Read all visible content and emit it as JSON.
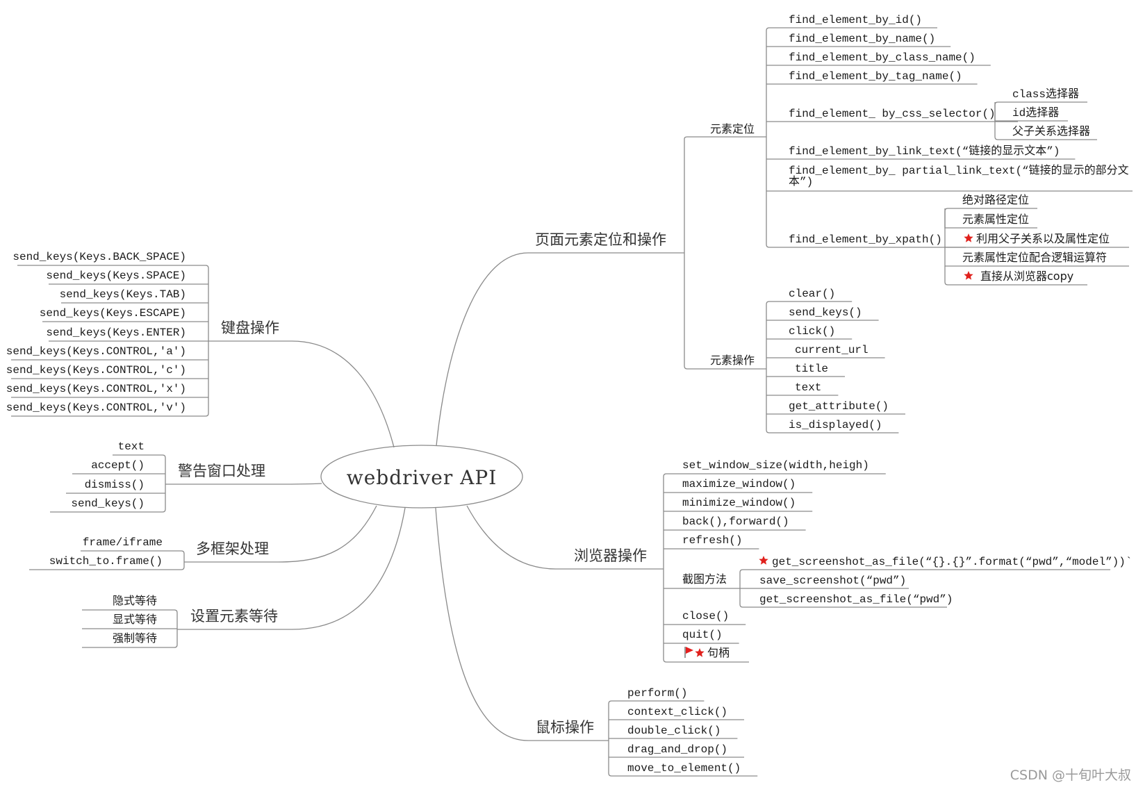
{
  "root": {
    "label": "webdriver API"
  },
  "watermark": "CSDN @十旬叶大叔",
  "colors": {
    "line": "#8a8a8a",
    "text": "#1a1a1a",
    "star": "#e0201c",
    "watermark": "#9a9a9a"
  },
  "branches": {
    "page_elements": {
      "label": "页面元素定位和操作",
      "locate": {
        "label": "元素定位",
        "items": [
          {
            "label": "find_element_by_id()"
          },
          {
            "label": "find_element_by_name()"
          },
          {
            "label": "find_element_by_class_name()"
          },
          {
            "label": "find_element_by_tag_name()"
          },
          {
            "label": "find_element_ by_css_selector()",
            "children": [
              "class选择器",
              "id选择器",
              "父子关系选择器"
            ]
          },
          {
            "label": "find_element_by_link_text(“链接的显示文本”)"
          },
          {
            "label": "find_element_by_ partial_link_text(“链接的显示的部分文",
            "label_line2": "本”)"
          },
          {
            "label": "find_element_by_xpath()",
            "children": [
              "绝对路径定位",
              "元素属性定位",
              "利用父子关系以及属性定位",
              "元素属性定位配合逻辑运算符",
              "直接从浏览器copy"
            ],
            "starred_children": [
              2,
              4
            ]
          }
        ]
      },
      "operate": {
        "label": "元素操作",
        "items": [
          "clear()",
          "send_keys()",
          "click()",
          "current_url",
          "title",
          "text",
          "get_attribute()",
          "is_displayed()"
        ]
      }
    },
    "browser": {
      "label": "浏览器操作",
      "items": [
        "set_window_size(width,heigh)",
        "maximize_window()",
        "minimize_window()",
        "back(),forward()",
        "refresh()"
      ],
      "screenshot": {
        "label": "截图方法",
        "items": [
          "get_screenshot_as_file(“{}.{}”.format(“pwd”,“model”))`",
          "save_screenshot(“pwd”)",
          "get_screenshot_as_file(“pwd”)"
        ],
        "starred_items": [
          0
        ]
      },
      "tail_items": [
        "close()",
        "quit()",
        "句柄"
      ],
      "handle_markers": [
        "flag-icon",
        "star-icon"
      ]
    },
    "mouse": {
      "label": "鼠标操作",
      "items": [
        "perform()",
        "context_click()",
        "double_click()",
        "drag_and_drop()",
        "move_to_element()"
      ]
    },
    "keyboard": {
      "label": "键盘操作",
      "items": [
        "send_keys(Keys.BACK_SPACE)",
        "send_keys(Keys.SPACE)",
        "send_keys(Keys.TAB)",
        "send_keys(Keys.ESCAPE)",
        "send_keys(Keys.ENTER)",
        "send_keys(Keys.CONTROL,'a')",
        "send_keys(Keys.CONTROL,'c')",
        "send_keys(Keys.CONTROL,'x')",
        "send_keys(Keys.CONTROL,'v')"
      ]
    },
    "alert": {
      "label": "警告窗口处理",
      "items": [
        "text",
        "accept()",
        "dismiss()",
        "send_keys()"
      ]
    },
    "frame": {
      "label": "多框架处理",
      "items": [
        "frame/iframe",
        "switch_to.frame()"
      ]
    },
    "wait": {
      "label": "设置元素等待",
      "items": [
        "隐式等待",
        "显式等待",
        "强制等待"
      ]
    }
  }
}
